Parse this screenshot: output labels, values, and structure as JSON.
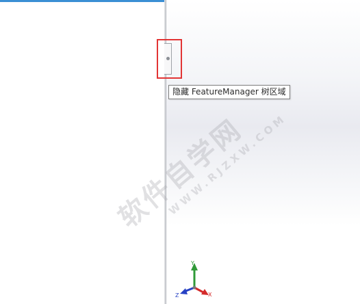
{
  "feature_manager": {
    "accent_color": "#3b8fd4",
    "collapse_handle_icon": "dot-grip-icon"
  },
  "tooltip": {
    "text": "隐藏 FeatureManager 树区域"
  },
  "highlight": {
    "color": "#e23434"
  },
  "watermark": {
    "main_text": "软件自学网",
    "sub_text": "WWW.RJZXW.COM"
  },
  "triad": {
    "x_label": "X",
    "y_label": "Y",
    "z_label": "Z",
    "x_color": "#d42a2a",
    "y_color": "#2f9a37",
    "z_color": "#2742c4"
  }
}
